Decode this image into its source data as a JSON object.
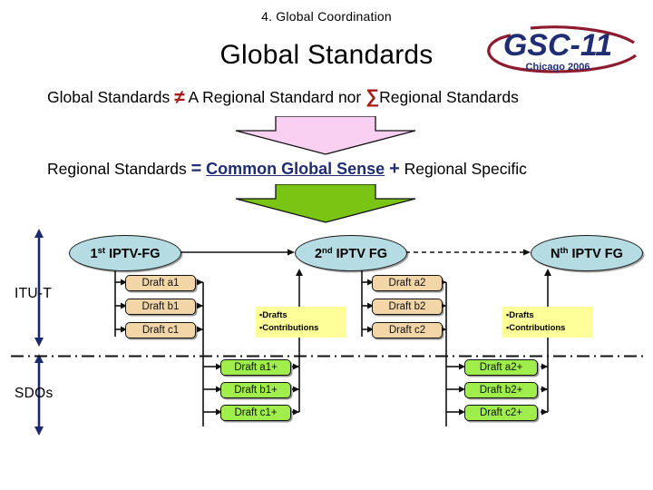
{
  "header": {
    "section_label": "4. Global Coordination",
    "title": "Global Standards"
  },
  "logo": {
    "name": "GSC-11",
    "tagline": "Chicago 2006",
    "text_color": "#1F2D73",
    "swoosh_color": "#8C1B2F"
  },
  "equations": {
    "line1": {
      "left": "Global Standards",
      "operator": "≠",
      "middle": "A Regional Standard nor",
      "sum_symbol": "∑",
      "right": "Regional Standards",
      "operator_color": "#A61B14"
    },
    "line2": {
      "left": "Regional Standards",
      "equals": "=",
      "emphasis": "Common Global Sense",
      "plus": "+",
      "right": "Regional Specific",
      "emphasis_color": "#1F2D73"
    }
  },
  "arrows": {
    "top_block_arrow_color": "#F9CFF2",
    "bottom_block_arrow_color": "#7AC414",
    "scope_arrow_color": "#1B2A6B"
  },
  "diagram": {
    "scopes": [
      {
        "label": "ITU-T"
      },
      {
        "label": "SDOs"
      }
    ],
    "groups": [
      {
        "label_prefix": "1",
        "label_sup": "st",
        "label_main": "IPTV-FG"
      },
      {
        "label_prefix": "2",
        "label_sup": "nd",
        "label_main": "IPTV FG"
      },
      {
        "label_prefix": "N",
        "label_sup": "th",
        "label_main": "IPTV FG"
      }
    ],
    "oval_fill": "#B4DCE2",
    "itu_drafts": {
      "fill": "#F2D6A8",
      "column1": [
        "Draft a1",
        "Draft b1",
        "Draft c1"
      ],
      "column2": [
        "Draft a2",
        "Draft b2",
        "Draft c2"
      ]
    },
    "sdo_drafts": {
      "fill": "#A0EE4C",
      "column1": [
        "Draft a1+",
        "Draft b1+",
        "Draft c1+"
      ],
      "column2": [
        "Draft a2+",
        "Draft b2+",
        "Draft c2+"
      ]
    },
    "notes": [
      {
        "bullet": "▪",
        "line1": "Drafts",
        "line2": "Contributions"
      },
      {
        "bullet": "▪",
        "line1": "Drafts",
        "line2": "Contributions"
      }
    ],
    "note_fill": "#FFFF99"
  }
}
